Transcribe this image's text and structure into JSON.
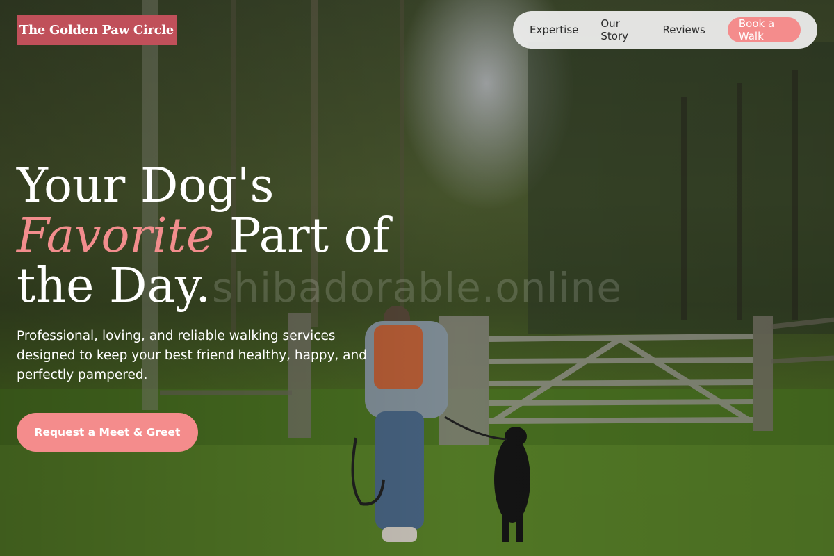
{
  "brand": {
    "name": "The Golden Paw Circle"
  },
  "nav": {
    "items": [
      {
        "label": "Expertise"
      },
      {
        "label": "Our Story"
      },
      {
        "label": "Reviews"
      }
    ],
    "cta_label": "Book a Walk"
  },
  "hero": {
    "headline_line1": "Your Dog's",
    "headline_accent": "Favorite",
    "headline_line2_rest": " Part of",
    "headline_line3": "the Day.",
    "subtitle": "Professional, loving, and reliable walking services designed to keep your best friend healthy, happy, and perfectly pampered.",
    "cta_label": "Request a Meet & Greet",
    "watermark": "shibadorable.online"
  },
  "colors": {
    "brand_red": "#c0505a",
    "accent_pink": "#f48c8c",
    "nav_bg": "#f0f0f0"
  }
}
